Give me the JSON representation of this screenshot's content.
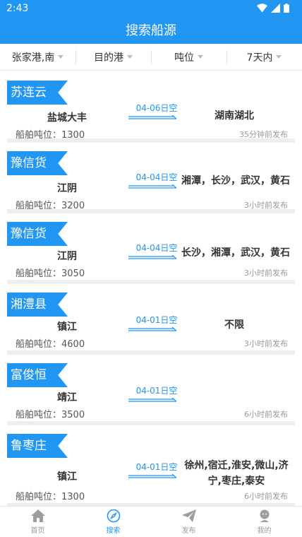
{
  "status": {
    "time": "2:43"
  },
  "header": {
    "title": "搜索船源"
  },
  "filters": [
    {
      "label": "张家港,南"
    },
    {
      "label": "目的港"
    },
    {
      "label": "吨位"
    },
    {
      "label": "7天内"
    }
  ],
  "cards": [
    {
      "tag": "苏连云",
      "origin": "盐城大丰",
      "date": "04-06日空",
      "dest": "湖南湖北",
      "tonnage": "船舶吨位：1300",
      "posted": "35分钟前发布"
    },
    {
      "tag": "豫信货",
      "origin": "江阴",
      "date": "04-04日空",
      "dest": "湘潭，长沙，武汉，黄石",
      "tonnage": "船舶吨位：3200",
      "posted": "3小时前发布"
    },
    {
      "tag": "豫信货",
      "origin": "江阴",
      "date": "04-04日空",
      "dest": "长沙，湘潭，武汉，黄石",
      "tonnage": "船舶吨位：3050",
      "posted": "3小时前发布"
    },
    {
      "tag": "湘澧县",
      "origin": "镇江",
      "date": "04-01日空",
      "dest": "不限",
      "tonnage": "船舶吨位：4600",
      "posted": "3小时前发布"
    },
    {
      "tag": "富俊恒",
      "origin": "靖江",
      "date": "04-01日空",
      "dest": "",
      "tonnage": "船舶吨位：3500",
      "posted": "6小时前发布"
    },
    {
      "tag": "鲁枣庄",
      "origin": "镇江",
      "date": "04-01日空",
      "dest": "徐州,宿迁,淮安,微山,济宁,枣庄,泰安",
      "tonnage": "船舶吨位：1300",
      "posted": "6小时前发布"
    }
  ],
  "tabbar": [
    {
      "label": "首页",
      "icon": "home-icon"
    },
    {
      "label": "搜索",
      "icon": "compass-icon"
    },
    {
      "label": "发布",
      "icon": "paper-plane-icon"
    },
    {
      "label": "我的",
      "icon": "user-icon"
    }
  ],
  "colors": {
    "primary": "#2196f3",
    "muted": "#999999"
  }
}
